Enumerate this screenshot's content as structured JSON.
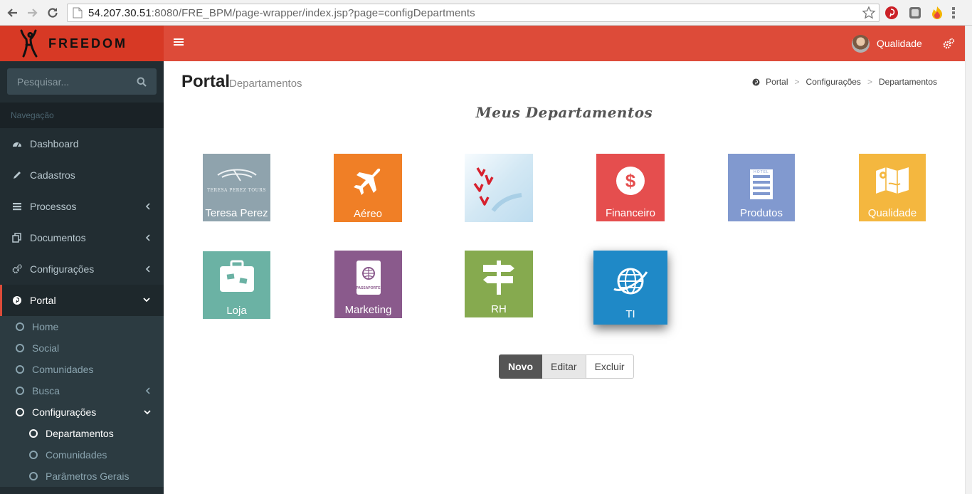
{
  "browser": {
    "url_host": "54.207.30.51",
    "url_rest": ":8080/FRE_BPM/page-wrapper/index.jsp?page=configDepartments"
  },
  "brand": {
    "name": "FREEDOM"
  },
  "header": {
    "user_name": "Qualidade"
  },
  "search": {
    "placeholder": "Pesquisar..."
  },
  "sidebar": {
    "header": "Navegação",
    "items": [
      {
        "label": "Dashboard",
        "icon": "dashboard-icon"
      },
      {
        "label": "Cadastros",
        "icon": "pencil-icon"
      },
      {
        "label": "Processos",
        "icon": "list-icon"
      },
      {
        "label": "Documentos",
        "icon": "copy-icon"
      },
      {
        "label": "Configurações",
        "icon": "gears-icon"
      },
      {
        "label": "Portal",
        "icon": "pinterest-icon"
      }
    ],
    "portal_sub": [
      "Home",
      "Social",
      "Comunidades",
      "Busca",
      "Configurações"
    ],
    "config_sub": [
      "Departamentos",
      "Comunidades",
      "Parâmetros Gerais"
    ]
  },
  "page": {
    "title": "Portal",
    "subtitle": "Departamentos"
  },
  "breadcrumb": [
    "Portal",
    "Configurações",
    "Departamentos"
  ],
  "section_title": "Meus Departamentos",
  "departments": [
    {
      "label": "Teresa Perez",
      "logo_text": "TERESA PEREZ TOURS",
      "color": "#8fa3ad"
    },
    {
      "label": "Aéreo",
      "color": "#f07f26"
    },
    {
      "label": "",
      "color": "#dfeef6"
    },
    {
      "label": "Financeiro",
      "color": "#e54e4e"
    },
    {
      "label": "Produtos",
      "logo_text": "HOTEL",
      "color": "#8199cf"
    },
    {
      "label": "Qualidade",
      "color": "#f4b73f"
    },
    {
      "label": "Loja",
      "color": "#6bb2a4"
    },
    {
      "label": "Marketing",
      "logo_text": "PASSAPORTE",
      "color": "#8a5a8c"
    },
    {
      "label": "RH",
      "color": "#86aa4f"
    },
    {
      "label": "TI",
      "color": "#1f89c7"
    }
  ],
  "actions": {
    "new": "Novo",
    "edit": "Editar",
    "delete": "Excluir"
  }
}
